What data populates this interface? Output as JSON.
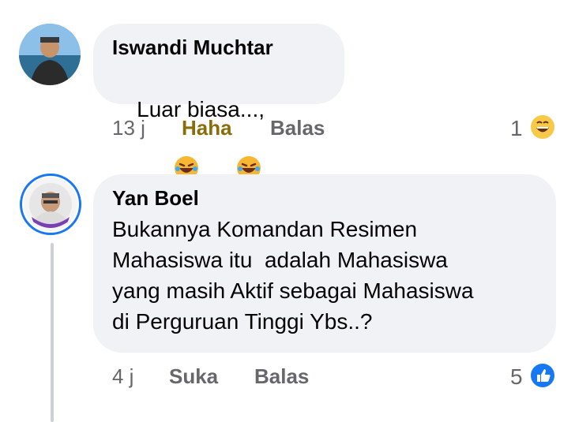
{
  "comments": [
    {
      "author": "Iswandi Muchtar",
      "text": "Luar biasa...,",
      "inline_emojis": [
        "laughing-crying-emoji",
        "laughing-crying-emoji"
      ],
      "time": "13 j",
      "reaction_action": "Haha",
      "reply_label": "Balas",
      "reaction_count": "1",
      "reaction_icon": "haha-reaction-icon"
    },
    {
      "author": "Yan Boel",
      "text": "Bukannya Komandan Resimen\nMahasiswa itu  adalah Mahasiswa\nyang masih Aktif sebagai Mahasiswa\ndi Perguruan Tinggi Ybs..?",
      "time": "4 j",
      "reaction_action": "Suka",
      "reply_label": "Balas",
      "reaction_count": "5",
      "reaction_icon": "like-reaction-icon"
    }
  ],
  "colors": {
    "bubble": "#f0f2f5",
    "meta": "#65676b",
    "haha_active": "#8a6d0b",
    "like_blue": "#1877f2"
  }
}
